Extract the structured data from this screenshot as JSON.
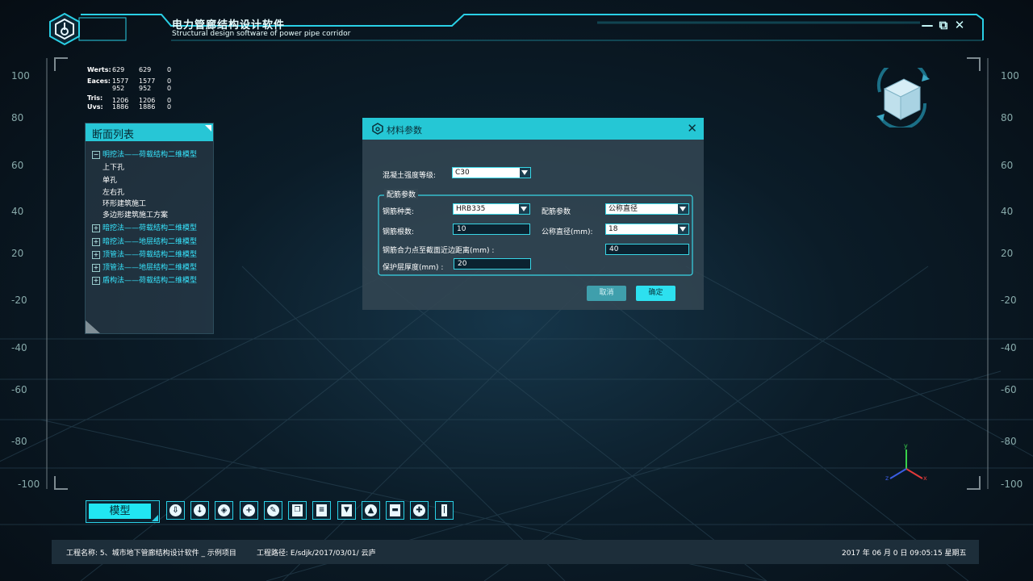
{
  "titlebar": {
    "title_cn": "电力管廊结构设计软件",
    "title_en": "Structural design software of power pipe corridor",
    "minimize": "—",
    "restore": "⧉",
    "close": "✕"
  },
  "ruler": {
    "left": [
      "100",
      "80",
      "60",
      "40",
      "20",
      "-20",
      "-40",
      "-60",
      "-80",
      "-100"
    ],
    "right": [
      "100",
      "80",
      "60",
      "40",
      "20",
      "-20",
      "-40",
      "-60",
      "-80",
      "-100"
    ]
  },
  "stats": {
    "verts": {
      "label": "Werts:",
      "a": "629",
      "b": "629",
      "c": "0"
    },
    "faces": {
      "label": "Eaces:",
      "a": "1577",
      "b": "1577",
      "c": "0"
    },
    "faces2": {
      "a": "952",
      "b": "952",
      "c": "0"
    },
    "tris": {
      "label": "Tris:",
      "a": "1206",
      "b": "1206",
      "c": "0"
    },
    "uvs": {
      "label": "Uvs:",
      "a": "1886",
      "b": "1886",
      "c": "0"
    }
  },
  "section_list": {
    "title": "断面列表",
    "groups": [
      {
        "label": "明挖法——荷载结构二维模型",
        "toggle": "−"
      },
      {
        "label": "暗挖法——荷载结构二维模型",
        "toggle": "+"
      },
      {
        "label": "暗挖法——地层结构二维模型",
        "toggle": "+"
      },
      {
        "label": "顶管法——荷载结构二维模型",
        "toggle": "+"
      },
      {
        "label": "顶管法——地层结构二维模型",
        "toggle": "+"
      },
      {
        "label": "盾构法——荷载结构二维模型",
        "toggle": "+"
      }
    ],
    "children": [
      "上下孔",
      "单孔",
      "左右孔",
      "环形建筑施工",
      "多边形建筑施工方案"
    ]
  },
  "dialog": {
    "title": "材料参数",
    "close": "✕",
    "concrete_label": "混凝土强度等级:",
    "concrete_value": "C30",
    "rebar_group": "配筋参数",
    "rebar_type_label": "钢筋种类:",
    "rebar_type_value": "HRB335",
    "rebar_param_label": "配筋参数",
    "rebar_param_value": "公称直径",
    "rebar_count_label": "钢筋根数:",
    "rebar_count_value": "10",
    "nominal_dia_label": "公称直径(mm):",
    "nominal_dia_value": "18",
    "distance_label": "钢筋合力点至截面近边距离(mm) :",
    "distance_value": "40",
    "cover_label": "保护层厚度(mm) :",
    "cover_value": "20",
    "cancel": "取消",
    "ok": "确定"
  },
  "toolbar": {
    "mode_label": "模型",
    "tools": [
      "download-icon",
      "download-circle-icon",
      "cube-icon",
      "add-circle-icon",
      "edit-icon",
      "copy-icon",
      "document-icon",
      "delete-icon",
      "shapes-icon",
      "platform-icon",
      "cross-icon",
      "column-icon"
    ]
  },
  "axis": {
    "y": "y",
    "x": "x",
    "z": "z"
  },
  "statusbar": {
    "project_name": "工程名称: 5、城市地下管廊结构设计软件 _ 示例项目",
    "project_path": "工程路径: E/sdjk/2017/03/01/ 云庐",
    "datetime": "2017 年 06 月 0 日 09:05:15  星期五"
  },
  "colors": {
    "accent": "#27c6d6",
    "background": "#0b1c28",
    "text": "#ffffff"
  }
}
